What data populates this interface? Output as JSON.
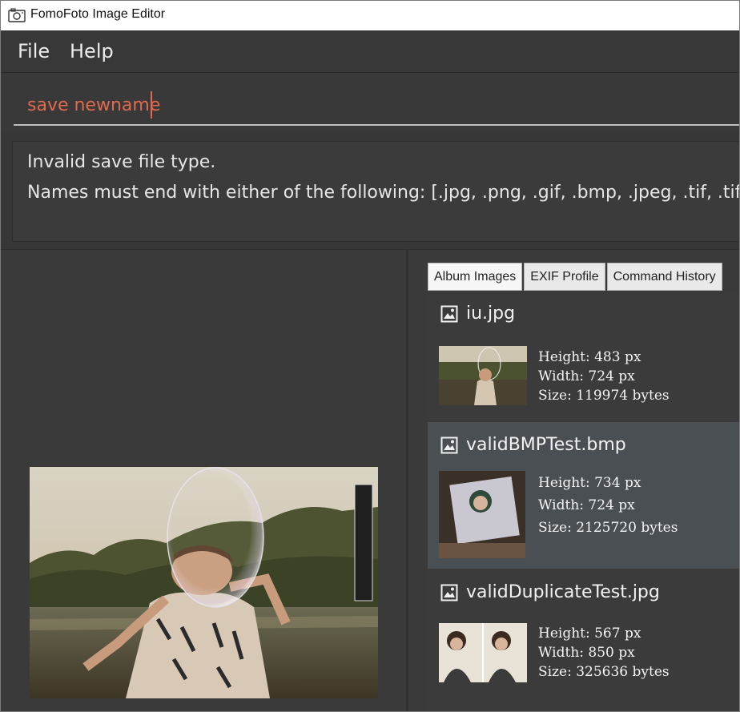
{
  "window": {
    "title": "FomoFoto Image Editor",
    "icon": "camera-icon"
  },
  "menu": {
    "file": "File",
    "help": "Help"
  },
  "command": {
    "value": "save newname"
  },
  "result": {
    "line1": "Invalid save file type.",
    "line2": "Names must end with either of the following: [.jpg, .png, .gif, .bmp, .jpeg, .tif, .tiff]"
  },
  "tabs": [
    {
      "label": "Album Images",
      "active": true
    },
    {
      "label": "EXIF Profile",
      "active": false
    },
    {
      "label": "Command History",
      "active": false
    }
  ],
  "album": [
    {
      "name": "iu.jpg",
      "height": "Height: 483 px",
      "width": "Width: 724 px",
      "size": "Size: 119974 bytes",
      "selected": false
    },
    {
      "name": "validBMPTest.bmp",
      "height": "Height: 734 px",
      "width": "Width: 724 px",
      "size": "Size: 2125720 bytes",
      "selected": true
    },
    {
      "name": "validDuplicateTest.jpg",
      "height": "Height: 567 px",
      "width": "Width: 850 px",
      "size": "Size: 325636 bytes",
      "selected": false
    }
  ],
  "colors": {
    "background": "#3a3a3a",
    "command_text": "#e06a4e",
    "selected_row": "#4a4f53"
  }
}
